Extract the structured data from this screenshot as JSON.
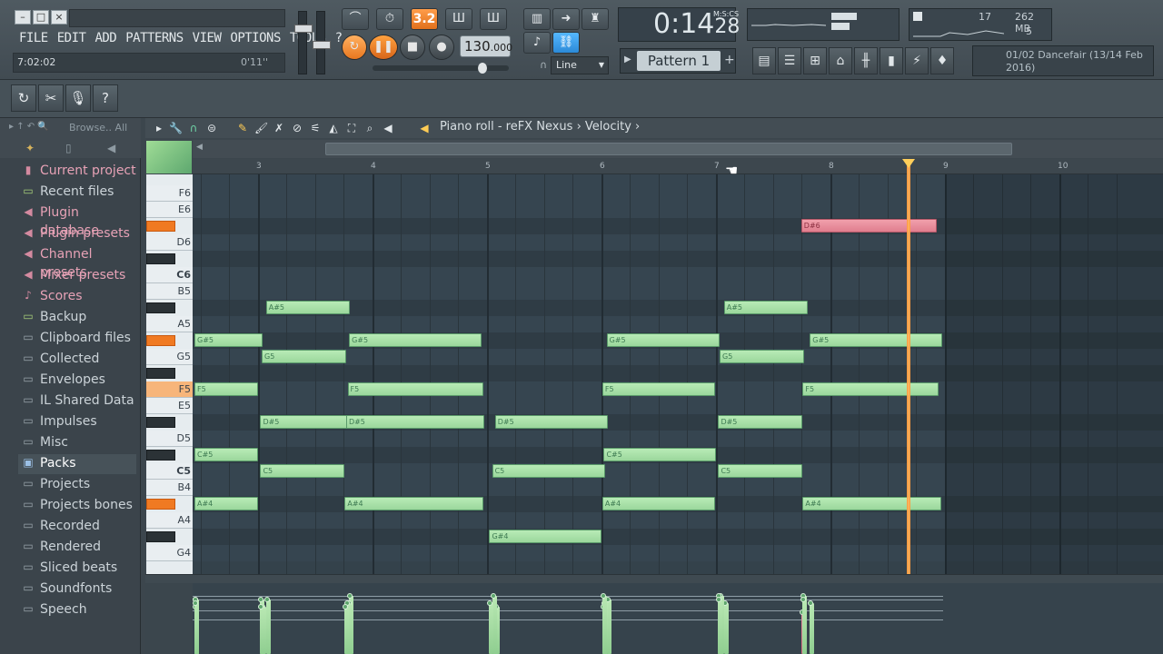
{
  "menu": [
    "FILE",
    "EDIT",
    "ADD",
    "PATTERNS",
    "VIEW",
    "OPTIONS",
    "TOOLS",
    "?"
  ],
  "hint": {
    "left": "7:02:02",
    "right": "0'11''"
  },
  "transport": {
    "pat_song": "3.2",
    "tempo_int": "130",
    "tempo_dec": ".000",
    "snap": "Line"
  },
  "time": {
    "main": "0:14",
    "sub": "28",
    "label": "M:S:CS"
  },
  "cpu": {
    "voices": "17",
    "memory": "262 MB",
    "polyphony": "5"
  },
  "pattern": {
    "name": "Pattern 1",
    "add": "+"
  },
  "news": {
    "text": "01/02  Dancefair (13/14 Feb 2016)"
  },
  "browser": {
    "title": "Browse.. All",
    "items": [
      {
        "label": "Current project",
        "type": "pink",
        "icon": "project-icon"
      },
      {
        "label": "Recent files",
        "type": "green",
        "icon": "recent-folder-icon"
      },
      {
        "label": "Plugin database",
        "type": "pink",
        "icon": "plugin-icon"
      },
      {
        "label": "Plugin presets",
        "type": "pink",
        "icon": "plugin-icon"
      },
      {
        "label": "Channel presets",
        "type": "pink",
        "icon": "plugin-icon"
      },
      {
        "label": "Mixer presets",
        "type": "pink",
        "icon": "plugin-icon"
      },
      {
        "label": "Scores",
        "type": "pink",
        "icon": "note-icon"
      },
      {
        "label": "Backup",
        "type": "green",
        "icon": "folder-icon"
      },
      {
        "label": "Clipboard files",
        "type": "",
        "icon": "folder-icon"
      },
      {
        "label": "Collected",
        "type": "",
        "icon": "folder-icon"
      },
      {
        "label": "Envelopes",
        "type": "",
        "icon": "folder-icon"
      },
      {
        "label": "IL Shared Data",
        "type": "",
        "icon": "folder-icon"
      },
      {
        "label": "Impulses",
        "type": "",
        "icon": "folder-icon"
      },
      {
        "label": "Misc",
        "type": "",
        "icon": "folder-icon"
      },
      {
        "label": "Packs",
        "type": "blue",
        "icon": "packs-icon",
        "sel": true
      },
      {
        "label": "Projects",
        "type": "",
        "icon": "folder-icon"
      },
      {
        "label": "Projects bones",
        "type": "",
        "icon": "folder-icon"
      },
      {
        "label": "Recorded",
        "type": "",
        "icon": "folder-icon"
      },
      {
        "label": "Rendered",
        "type": "",
        "icon": "folder-icon"
      },
      {
        "label": "Sliced beats",
        "type": "",
        "icon": "folder-icon"
      },
      {
        "label": "Soundfonts",
        "type": "",
        "icon": "folder-icon"
      },
      {
        "label": "Speech",
        "type": "",
        "icon": "folder-icon"
      }
    ]
  },
  "pianoroll": {
    "crumb_title": "Piano roll - reFX Nexus",
    "crumb_sep": "›",
    "crumb_param": "Velocity",
    "bars": [
      "3",
      "4",
      "5",
      "6",
      "7",
      "8",
      "9",
      "10"
    ],
    "keys": [
      "F6",
      "E6",
      "D6",
      "C6",
      "B5",
      "A5",
      "G5",
      "F5",
      "E5",
      "D5",
      "C5",
      "B4",
      "A4",
      "G4"
    ]
  },
  "notes": [
    {
      "label": "D#6",
      "row": 3,
      "beat": 21.2,
      "len": 4.8,
      "red": true
    },
    {
      "label": "A#5",
      "row": 8,
      "beat": 2.5,
      "len": 3.0
    },
    {
      "label": "A#5",
      "row": 8,
      "beat": 18.5,
      "len": 3.0
    },
    {
      "label": "G#5",
      "row": 10,
      "beat": 0.0,
      "len": 2.45
    },
    {
      "label": "G#5",
      "row": 10,
      "beat": 5.4,
      "len": 4.7
    },
    {
      "label": "G#5",
      "row": 10,
      "beat": 14.4,
      "len": 4.0
    },
    {
      "label": "G#5",
      "row": 10,
      "beat": 21.5,
      "len": 4.7
    },
    {
      "label": "G5",
      "row": 11,
      "beat": 2.35,
      "len": 3.0
    },
    {
      "label": "G5",
      "row": 11,
      "beat": 18.35,
      "len": 3.0
    },
    {
      "label": "F5",
      "row": 13,
      "beat": 0.0,
      "len": 2.3
    },
    {
      "label": "F5",
      "row": 13,
      "beat": 5.35,
      "len": 4.8
    },
    {
      "label": "F5",
      "row": 13,
      "beat": 14.25,
      "len": 4.0
    },
    {
      "label": "F5",
      "row": 13,
      "beat": 21.25,
      "len": 4.8
    },
    {
      "label": "D#5",
      "row": 15,
      "beat": 2.3,
      "len": 3.1
    },
    {
      "label": "D#5",
      "row": 15,
      "beat": 5.3,
      "len": 4.9
    },
    {
      "label": "D#5",
      "row": 15,
      "beat": 10.5,
      "len": 4.0
    },
    {
      "label": "D#5",
      "row": 15,
      "beat": 18.3,
      "len": 3.0
    },
    {
      "label": "C#5",
      "row": 17,
      "beat": 0.0,
      "len": 2.3
    },
    {
      "label": "C#5",
      "row": 17,
      "beat": 14.3,
      "len": 4.0
    },
    {
      "label": "C5",
      "row": 18,
      "beat": 2.3,
      "len": 3.0
    },
    {
      "label": "C5",
      "row": 18,
      "beat": 10.4,
      "len": 4.0
    },
    {
      "label": "C5",
      "row": 18,
      "beat": 18.3,
      "len": 3.0
    },
    {
      "label": "A#4",
      "row": 20,
      "beat": 0.0,
      "len": 2.3
    },
    {
      "label": "A#4",
      "row": 20,
      "beat": 5.25,
      "len": 4.9
    },
    {
      "label": "A#4",
      "row": 20,
      "beat": 14.25,
      "len": 4.0
    },
    {
      "label": "A#4",
      "row": 20,
      "beat": 21.25,
      "len": 4.9
    },
    {
      "label": "G#4",
      "row": 22,
      "beat": 10.3,
      "len": 4.0
    }
  ]
}
